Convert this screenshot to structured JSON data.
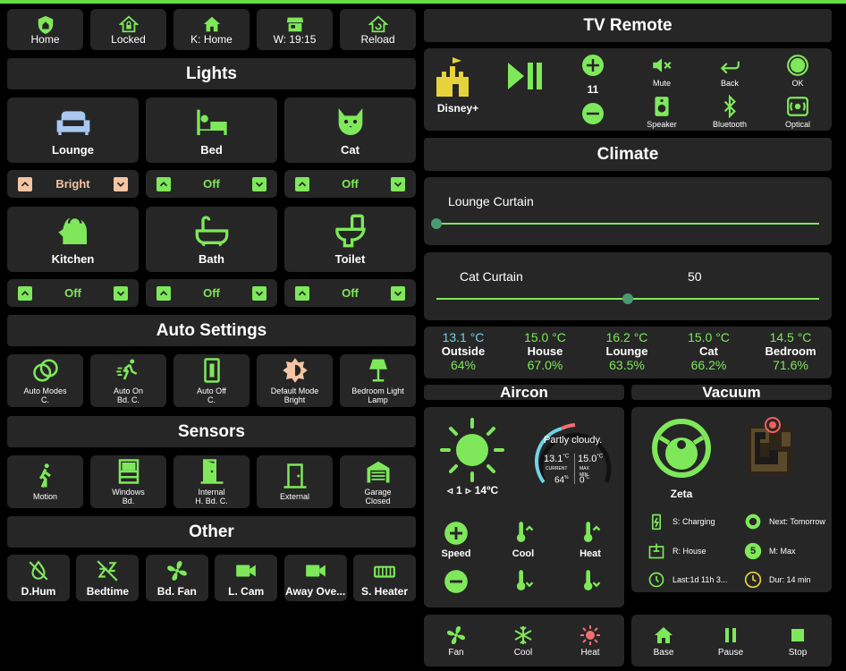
{
  "top_nav": [
    {
      "label": "Home",
      "icon": "shield-home-icon"
    },
    {
      "label": "Locked",
      "icon": "home-lock-icon"
    },
    {
      "label": "K: Home",
      "icon": "home-icon"
    },
    {
      "label": "W: 19:15",
      "icon": "store-icon"
    },
    {
      "label": "Reload",
      "icon": "home-reload-icon"
    }
  ],
  "lights": {
    "title": "Lights",
    "tiles": [
      {
        "label": "Lounge",
        "icon": "sofa-icon",
        "color": "#a8c8f0"
      },
      {
        "label": "Bed",
        "icon": "bed-icon",
        "color": "#7ee85a"
      },
      {
        "label": "Cat",
        "icon": "cat-icon",
        "color": "#7ee85a"
      },
      {
        "label": "Kitchen",
        "icon": "kettle-icon",
        "color": "#7ee85a"
      },
      {
        "label": "Bath",
        "icon": "bathtub-icon",
        "color": "#7ee85a"
      },
      {
        "label": "Toilet",
        "icon": "toilet-icon",
        "color": "#7ee85a"
      }
    ],
    "controls": [
      {
        "value": "Bright",
        "accent": "#f6c5a5"
      },
      {
        "value": "Off",
        "accent": "#7ee85a"
      },
      {
        "value": "Off",
        "accent": "#7ee85a"
      },
      {
        "value": "Off",
        "accent": "#7ee85a"
      },
      {
        "value": "Off",
        "accent": "#7ee85a"
      },
      {
        "value": "Off",
        "accent": "#7ee85a"
      }
    ]
  },
  "auto_settings": {
    "title": "Auto Settings",
    "tiles": [
      {
        "line1": "Auto Modes",
        "line2": "C.",
        "icon": "circles-icon"
      },
      {
        "line1": "Auto On",
        "line2": "Bd. C.",
        "icon": "run-icon"
      },
      {
        "line1": "Auto Off",
        "line2": "C.",
        "icon": "switch-icon"
      },
      {
        "line1": "Default Mode",
        "line2": "Bright",
        "icon": "brightness-icon"
      },
      {
        "line1": "Bedroom Light",
        "line2": "Lamp",
        "icon": "lamp-icon"
      }
    ]
  },
  "sensors": {
    "title": "Sensors",
    "tiles": [
      {
        "line1": "Motion",
        "line2": "",
        "icon": "walk-icon"
      },
      {
        "line1": "Windows",
        "line2": "Bd.",
        "icon": "window-icon"
      },
      {
        "line1": "Internal",
        "line2": "H. Bd. C.",
        "icon": "door-open-icon"
      },
      {
        "line1": "External",
        "line2": "",
        "icon": "door-icon"
      },
      {
        "line1": "Garage",
        "line2": "Closed",
        "icon": "garage-icon"
      }
    ]
  },
  "other": {
    "title": "Other",
    "tiles": [
      {
        "label": "D.Hum",
        "icon": "water-off-icon"
      },
      {
        "label": "Bedtime",
        "icon": "sleep-icon"
      },
      {
        "label": "Bd. Fan",
        "icon": "fan-icon"
      },
      {
        "label": "L. Cam",
        "icon": "video-icon"
      },
      {
        "label": "Away Ove...",
        "icon": "video-icon"
      },
      {
        "label": "S. Heater",
        "icon": "heater-icon"
      }
    ]
  },
  "tv_remote": {
    "title": "TV Remote",
    "source": "Disney+",
    "volume": "11",
    "buttons": [
      {
        "label": "Mute",
        "icon": "volume-mute-icon"
      },
      {
        "label": "Back",
        "icon": "back-icon"
      },
      {
        "label": "OK",
        "icon": "ok-circle-icon"
      },
      {
        "label": "Speaker",
        "icon": "speaker-icon"
      },
      {
        "label": "Bluetooth",
        "icon": "bluetooth-icon"
      },
      {
        "label": "Optical",
        "icon": "optical-icon"
      }
    ]
  },
  "climate": {
    "title": "Climate",
    "lounge_curtain": {
      "label": "Lounge Curtain",
      "position": 0
    },
    "cat_curtain": {
      "label": "Cat Curtain",
      "value": "50",
      "position": 50
    },
    "rooms": [
      {
        "temp": "13.1 °C",
        "name": "Outside",
        "humidity": "64%",
        "temp_color": "#6fd3e8"
      },
      {
        "temp": "15.0 °C",
        "name": "House",
        "humidity": "67.0%",
        "temp_color": "#7ee85a"
      },
      {
        "temp": "16.2 °C",
        "name": "Lounge",
        "humidity": "63.5%",
        "temp_color": "#7ee85a"
      },
      {
        "temp": "15.0 °C",
        "name": "Cat",
        "humidity": "66.2%",
        "temp_color": "#7ee85a"
      },
      {
        "temp": "14.5 °C",
        "name": "Bedroom",
        "humidity": "71.6%",
        "temp_color": "#7ee85a"
      }
    ]
  },
  "aircon": {
    "title": "Aircon",
    "uv": "1",
    "outdoor_temp": "14ºC",
    "condition": "Partly cloudy.",
    "current_temp": "13.1",
    "current_label": "CURRENT",
    "max_temp": "15.0",
    "max_label": "MAX",
    "min_label": "MIN",
    "min_temp": "0",
    "humidity": "64",
    "controls": [
      {
        "label": "Speed",
        "icon": "plus-circle-icon"
      },
      {
        "label": "Cool",
        "icon": "thermometer-up-icon"
      },
      {
        "label": "Heat",
        "icon": "thermometer-up-icon"
      }
    ],
    "modes": [
      {
        "label": "Fan",
        "icon": "fan-icon",
        "color": "#7ee85a"
      },
      {
        "label": "Cool",
        "icon": "snowflake-icon",
        "color": "#7ee85a"
      },
      {
        "label": "Heat",
        "icon": "sun-icon",
        "color": "#f07070"
      }
    ]
  },
  "vacuum": {
    "title": "Vacuum",
    "name": "Zeta",
    "status": "S:  Charging",
    "next": "Next: Tomorrow",
    "room": "R:    House",
    "mode_num": "5",
    "mode": "M:    Max",
    "last": "Last:1d 11h 3...",
    "duration": "Dur:    14 min",
    "actions": [
      {
        "label": "Base",
        "icon": "home-icon"
      },
      {
        "label": "Pause",
        "icon": "pause-icon"
      },
      {
        "label": "Stop",
        "icon": "stop-icon"
      }
    ]
  },
  "colors": {
    "accent": "#7ee85a",
    "card": "#262626",
    "background": "#000000"
  }
}
